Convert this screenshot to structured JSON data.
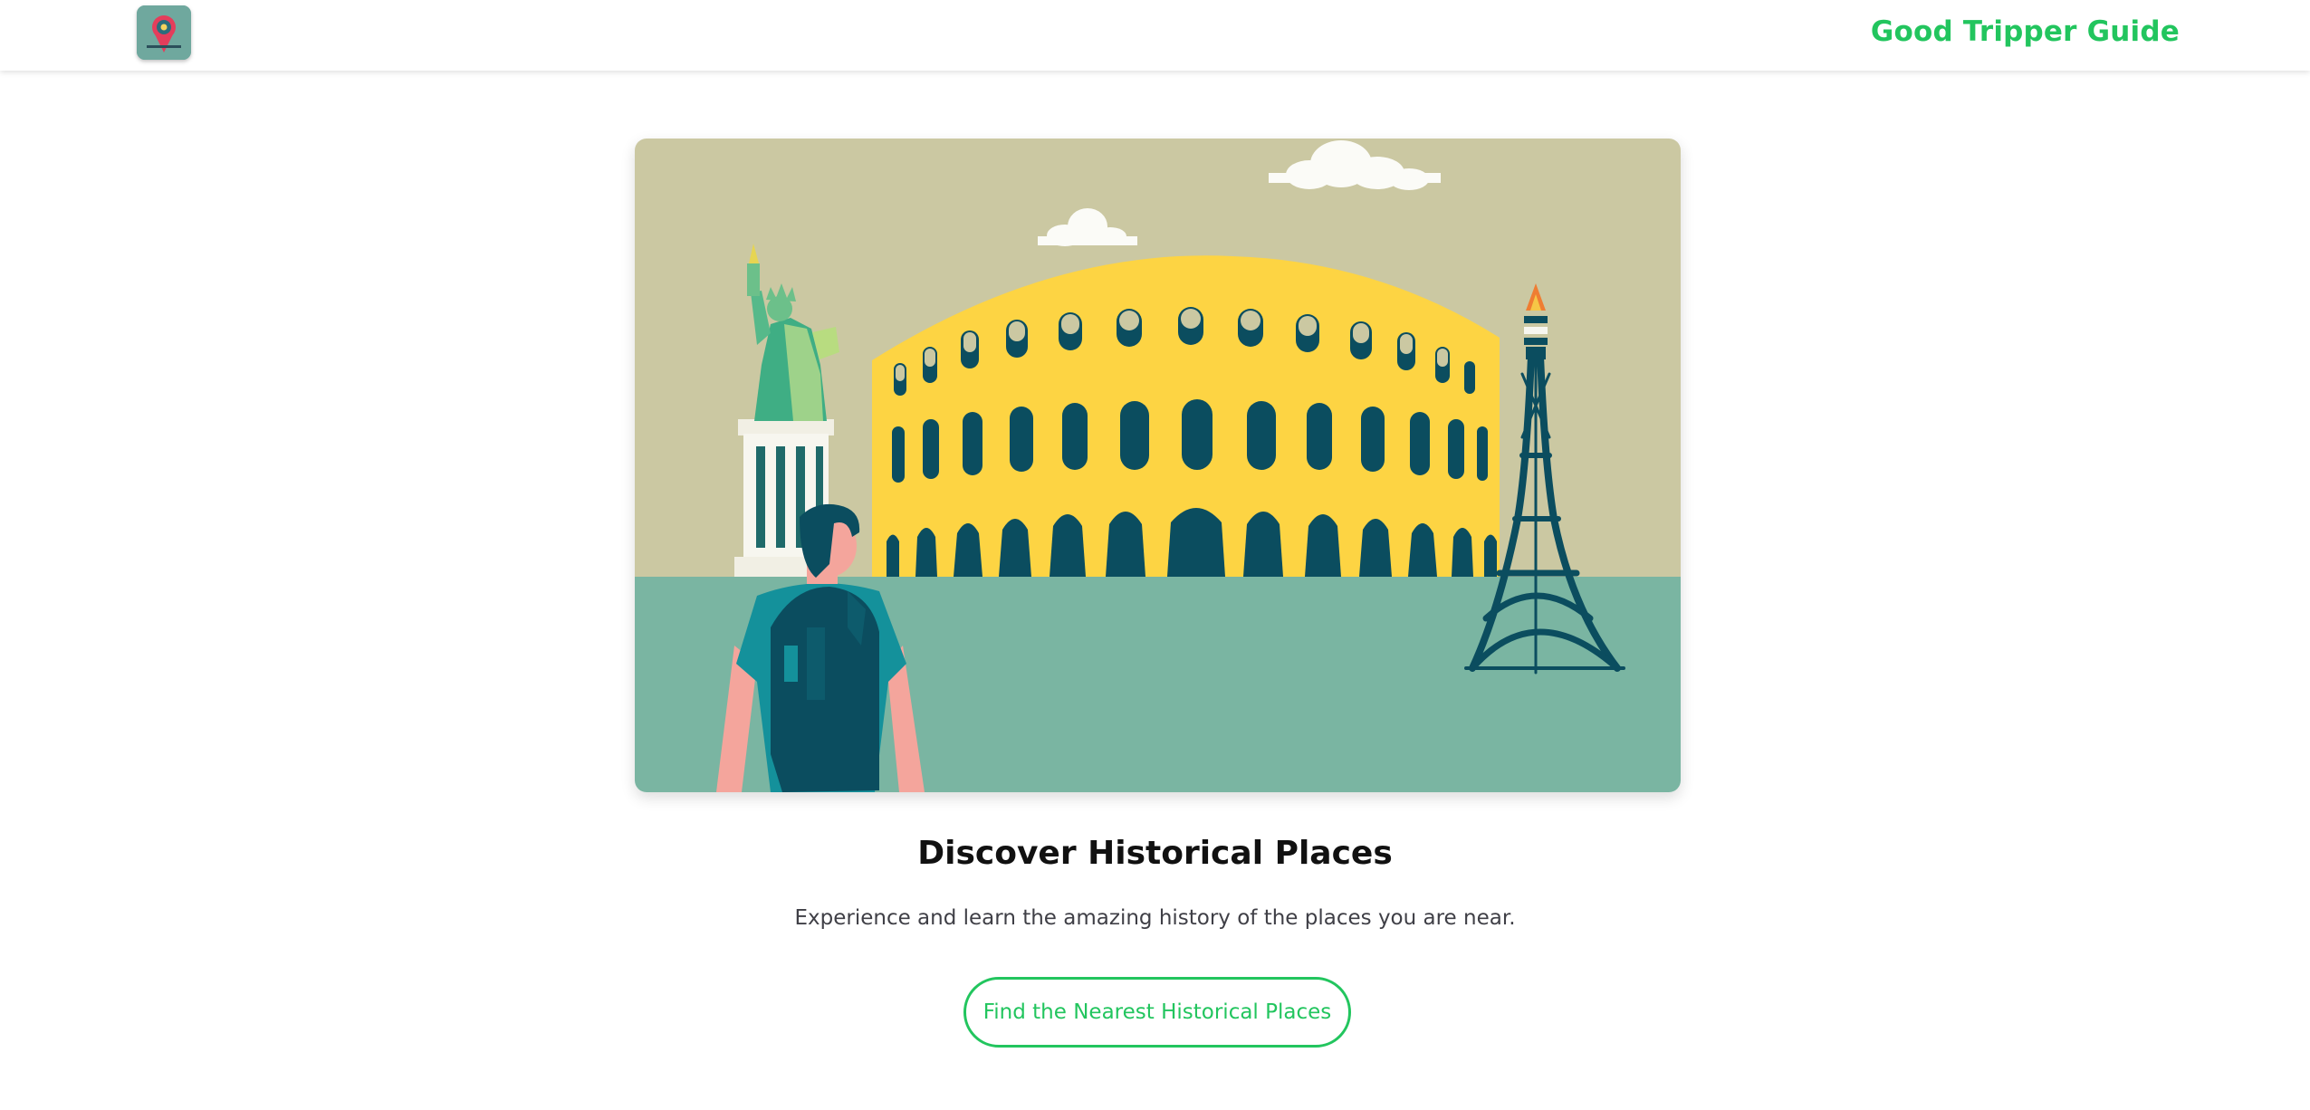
{
  "header": {
    "logo_icon": "map-pin-logo-icon",
    "brand_name": "Good Tripper Guide",
    "brand_color": "#22c55e"
  },
  "hero": {
    "illustration": "historical-landmarks-illustration",
    "landmarks": [
      "statue-of-liberty",
      "colosseum",
      "eiffel-tower"
    ],
    "colors": {
      "sky": "#cbc8a2",
      "ground": "#7ab5a2",
      "colosseum": "#fdd443",
      "dark": "#0b4d5f"
    }
  },
  "content": {
    "title": "Discover Historical Places",
    "subtitle": "Experience and learn the amazing history of the places you are near.",
    "cta_label": "Find the Nearest Historical Places"
  }
}
